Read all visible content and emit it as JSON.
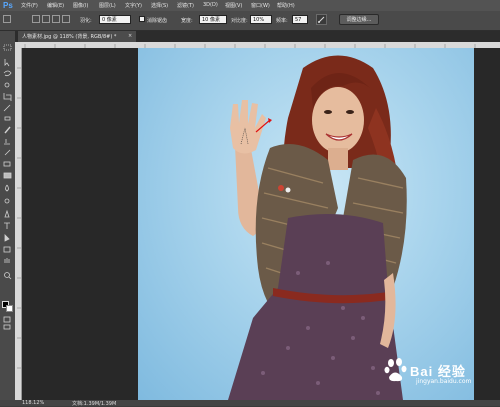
{
  "app": {
    "logo": "Ps"
  },
  "menu": [
    "文件(F)",
    "编辑(E)",
    "图像(I)",
    "图层(L)",
    "文字(Y)",
    "选择(S)",
    "滤镜(T)",
    "3D(D)",
    "视图(V)",
    "窗口(W)",
    "帮助(H)"
  ],
  "options": {
    "feather_label": "羽化:",
    "feather_value": "0 像素",
    "antialias_label": "消除锯齿",
    "style_label": "宽度:",
    "width_value": "10 像素",
    "contrast_label": "对比度:",
    "contrast_value": "10%",
    "frequency_label": "频率:",
    "frequency_value": "57",
    "refine_edge": "调整边缘..."
  },
  "document": {
    "tab_title": "人物素材.jpg @ 118% (背景, RGB/8#) *",
    "close": "×"
  },
  "status": {
    "zoom": "118.12%",
    "doc_info": "文档:1.39M/1.39M"
  },
  "watermark": {
    "text": "Bai 经验",
    "url": "jingyan.baidu.com"
  },
  "colors": {
    "photo_bg": "#a7d3ec",
    "vest": "#6b5a48",
    "dress": "#5a3f55",
    "skin": "#e2b79b",
    "hair": "#7a2a1a",
    "belt": "#8a2a1f"
  },
  "icons": [
    "marquee-icon",
    "move-icon",
    "lasso-icon",
    "quick-select-icon",
    "crop-icon",
    "eyedropper-icon",
    "healing-icon",
    "brush-icon",
    "stamp-icon",
    "history-brush-icon",
    "eraser-icon",
    "gradient-icon",
    "blur-icon",
    "dodge-icon",
    "pen-icon",
    "type-icon",
    "path-select-icon",
    "shape-icon",
    "hand-icon",
    "zoom-icon"
  ]
}
